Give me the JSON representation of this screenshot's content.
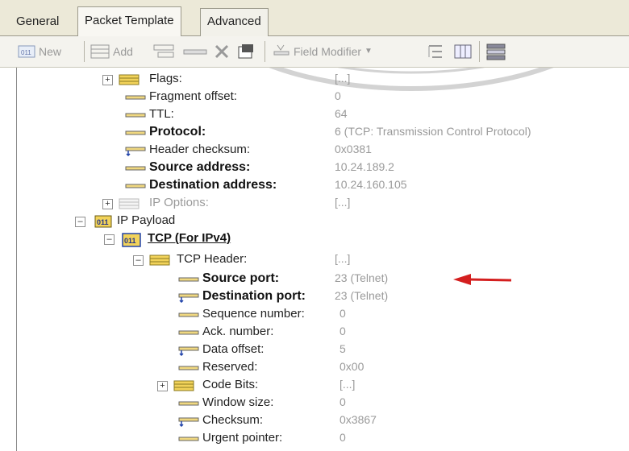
{
  "tabs": [
    {
      "label": "General"
    },
    {
      "label": "Packet Template"
    },
    {
      "label": "Advanced"
    }
  ],
  "active_tab": "Packet Template",
  "toolbar": {
    "new_label": "New",
    "add_label": "Add",
    "field_modifier_label": "Field Modifier"
  },
  "rows": [
    {
      "label": "Flags:",
      "value": "[...]"
    },
    {
      "label": "Fragment offset:",
      "value": "0"
    },
    {
      "label": "TTL:",
      "value": "64"
    },
    {
      "label": "Protocol:",
      "value": "6 (TCP: Transmission Control Protocol)"
    },
    {
      "label": "Header checksum:",
      "value": "0x0381"
    },
    {
      "label": "Source address:",
      "value": "10.24.189.2"
    },
    {
      "label": "Destination address:",
      "value": "10.24.160.105"
    },
    {
      "label": "IP Options:",
      "value": "[...]"
    },
    {
      "label": "IP Payload",
      "value": ""
    },
    {
      "label": "TCP (For IPv4)",
      "value": ""
    },
    {
      "label": "TCP Header:",
      "value": "[...]"
    },
    {
      "label": "Source port:",
      "value": "23 (Telnet)"
    },
    {
      "label": "Destination port:",
      "value": "23 (Telnet)"
    },
    {
      "label": "Sequence number:",
      "value": "0"
    },
    {
      "label": "Ack. number:",
      "value": "0"
    },
    {
      "label": "Data offset:",
      "value": "5"
    },
    {
      "label": "Reserved:",
      "value": "0x00"
    },
    {
      "label": "Code Bits:",
      "value": "[...]"
    },
    {
      "label": "Window size:",
      "value": "0"
    },
    {
      "label": "Checksum:",
      "value": "0x3867"
    },
    {
      "label": "Urgent pointer:",
      "value": "0"
    }
  ],
  "icon_text": "011"
}
